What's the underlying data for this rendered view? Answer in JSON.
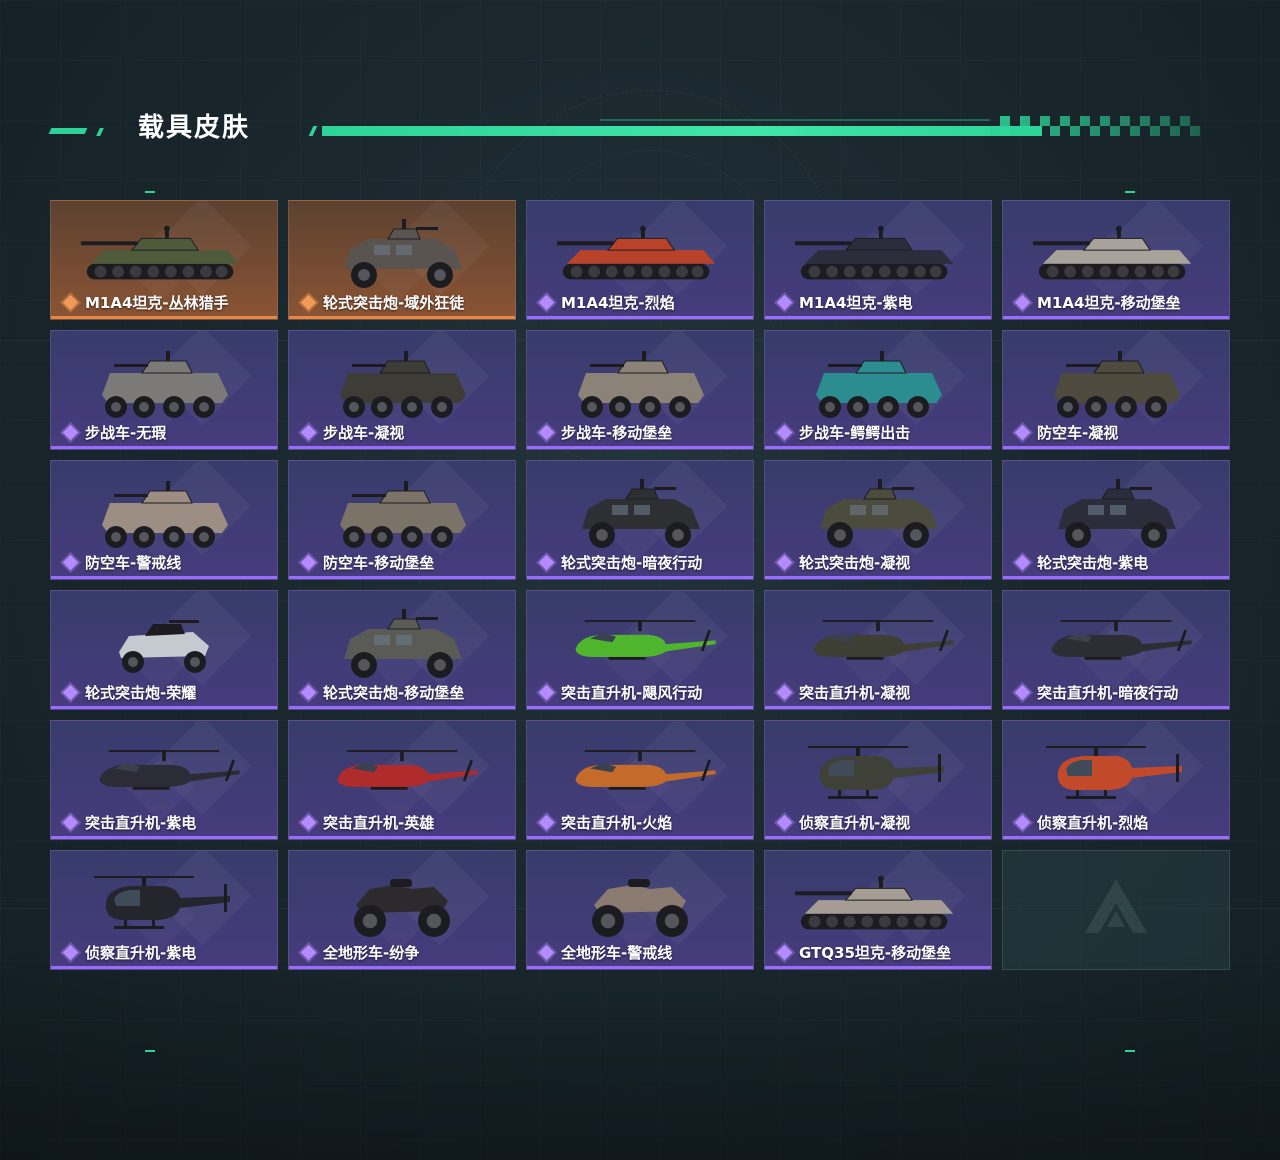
{
  "header": {
    "title": "载具皮肤"
  },
  "colors": {
    "accent": "#2ed397",
    "rare_purple": "#9a6bff",
    "legend_orange": "#e88745"
  },
  "skins": [
    {
      "name": "M1A4坦克-丛林猎手",
      "rarity": "gold",
      "type": "tank",
      "camo": "#4f5a3a"
    },
    {
      "name": "轮式突击炮-域外狂徒",
      "rarity": "gold",
      "type": "armored",
      "camo": "#5a5450"
    },
    {
      "name": "M1A4坦克-烈焰",
      "rarity": "purple",
      "type": "tank",
      "camo": "#b8432a"
    },
    {
      "name": "M1A4坦克-紫电",
      "rarity": "purple",
      "type": "tank",
      "camo": "#2c2d3c"
    },
    {
      "name": "M1A4坦克-移动堡垒",
      "rarity": "purple",
      "type": "tank",
      "camo": "#a8a29a"
    },
    {
      "name": "步战车-无瑕",
      "rarity": "purple",
      "type": "ifv",
      "camo": "#7c7a78"
    },
    {
      "name": "步战车-凝视",
      "rarity": "purple",
      "type": "ifv",
      "camo": "#3d3c37"
    },
    {
      "name": "步战车-移动堡垒",
      "rarity": "purple",
      "type": "ifv",
      "camo": "#8c8378"
    },
    {
      "name": "步战车-鳄鳄出击",
      "rarity": "purple",
      "type": "ifv",
      "camo": "#2b8d8f"
    },
    {
      "name": "防空车-凝视",
      "rarity": "purple",
      "type": "ifv",
      "camo": "#4e4a3e"
    },
    {
      "name": "防空车-警戒线",
      "rarity": "purple",
      "type": "ifv",
      "camo": "#9c8e82"
    },
    {
      "name": "防空车-移动堡垒",
      "rarity": "purple",
      "type": "ifv",
      "camo": "#7b7268"
    },
    {
      "name": "轮式突击炮-暗夜行动",
      "rarity": "purple",
      "type": "armored",
      "camo": "#2e2f33"
    },
    {
      "name": "轮式突击炮-凝视",
      "rarity": "purple",
      "type": "armored",
      "camo": "#4c4c3e"
    },
    {
      "name": "轮式突击炮-紫电",
      "rarity": "purple",
      "type": "armored",
      "camo": "#2c2d3b"
    },
    {
      "name": "轮式突击炮-荣耀",
      "rarity": "purple",
      "type": "buggy",
      "camo": "#c5c9d0"
    },
    {
      "name": "轮式突击炮-移动堡垒",
      "rarity": "purple",
      "type": "armored",
      "camo": "#5a5a56"
    },
    {
      "name": "突击直升机-飓风行动",
      "rarity": "purple",
      "type": "attack-heli",
      "camo": "#4fb52d"
    },
    {
      "name": "突击直升机-凝视",
      "rarity": "purple",
      "type": "attack-heli",
      "camo": "#3d3f35"
    },
    {
      "name": "突击直升机-暗夜行动",
      "rarity": "purple",
      "type": "attack-heli",
      "camo": "#2c2e33"
    },
    {
      "name": "突击直升机-紫电",
      "rarity": "purple",
      "type": "attack-heli",
      "camo": "#2b2c36"
    },
    {
      "name": "突击直升机-英雄",
      "rarity": "purple",
      "type": "attack-heli",
      "camo": "#b02b2b"
    },
    {
      "name": "突击直升机-火焰",
      "rarity": "purple",
      "type": "attack-heli",
      "camo": "#c46a2a"
    },
    {
      "name": "侦察直升机-凝视",
      "rarity": "purple",
      "type": "scout-heli",
      "camo": "#3f4138"
    },
    {
      "name": "侦察直升机-烈焰",
      "rarity": "purple",
      "type": "scout-heli",
      "camo": "#c2492a"
    },
    {
      "name": "侦察直升机-紫电",
      "rarity": "purple",
      "type": "scout-heli",
      "camo": "#25252d"
    },
    {
      "name": "全地形车-纷争",
      "rarity": "purple",
      "type": "atv",
      "camo": "#2c2a2c"
    },
    {
      "name": "全地形车-警戒线",
      "rarity": "purple",
      "type": "atv",
      "camo": "#8b7a70"
    },
    {
      "name": "GTQ35坦克-移动堡垒",
      "rarity": "purple",
      "type": "tank",
      "camo": "#a59d94"
    }
  ]
}
